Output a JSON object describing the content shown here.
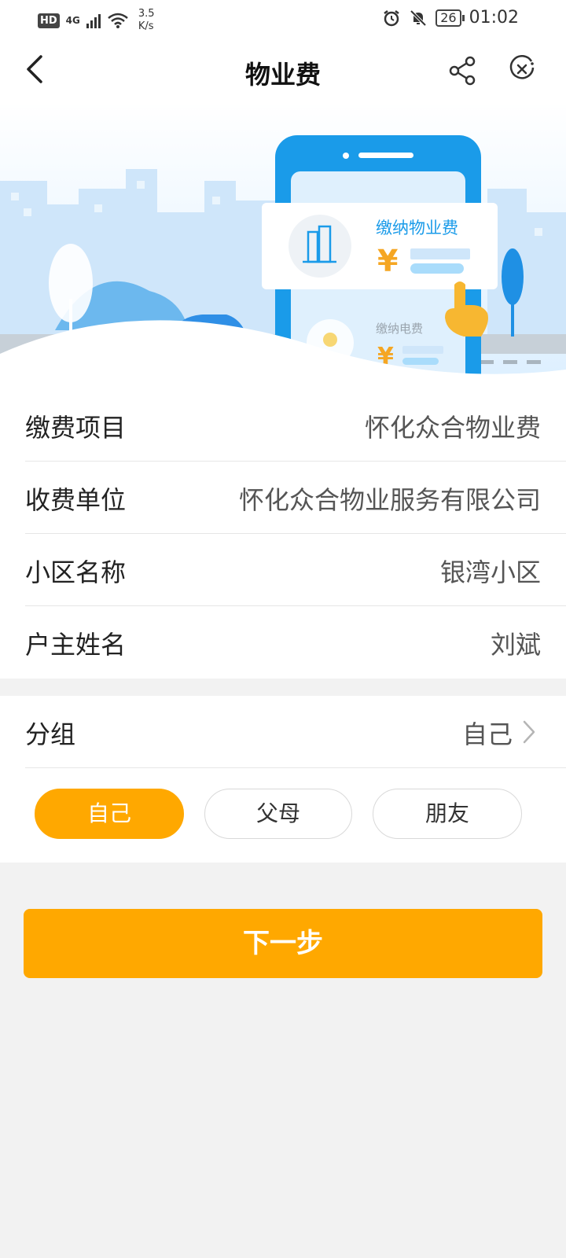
{
  "status_bar": {
    "hd": "HD",
    "network": "4G",
    "speed_value": "3.5",
    "speed_unit": "K/s",
    "battery": "26",
    "time": "01:02"
  },
  "nav": {
    "title": "物业费",
    "icons": [
      "back-icon",
      "share-icon",
      "close-circle-icon"
    ]
  },
  "banner": {
    "card_title": "缴纳物业费",
    "card_symbol": "¥",
    "secondary_title": "缴纳电费",
    "secondary_symbol": "¥",
    "colors": {
      "accent_blue": "#1a9be9",
      "sky": "#d7ecf9",
      "yuan_orange": "#f5a623"
    }
  },
  "info": {
    "rows": [
      {
        "label": "缴费项目",
        "value": "怀化众合物业费"
      },
      {
        "label": "收费单位",
        "value": "怀化众合物业服务有限公司"
      },
      {
        "label": "小区名称",
        "value": "银湾小区"
      },
      {
        "label": "户主姓名",
        "value": "刘斌"
      }
    ]
  },
  "group": {
    "label": "分组",
    "value": "自己",
    "options": [
      {
        "label": "自己",
        "selected": true
      },
      {
        "label": "父母",
        "selected": false
      },
      {
        "label": "朋友",
        "selected": false
      }
    ]
  },
  "next_button": {
    "label": "下一步"
  },
  "colors": {
    "primary": "#ffa800",
    "background": "#f2f2f2"
  }
}
